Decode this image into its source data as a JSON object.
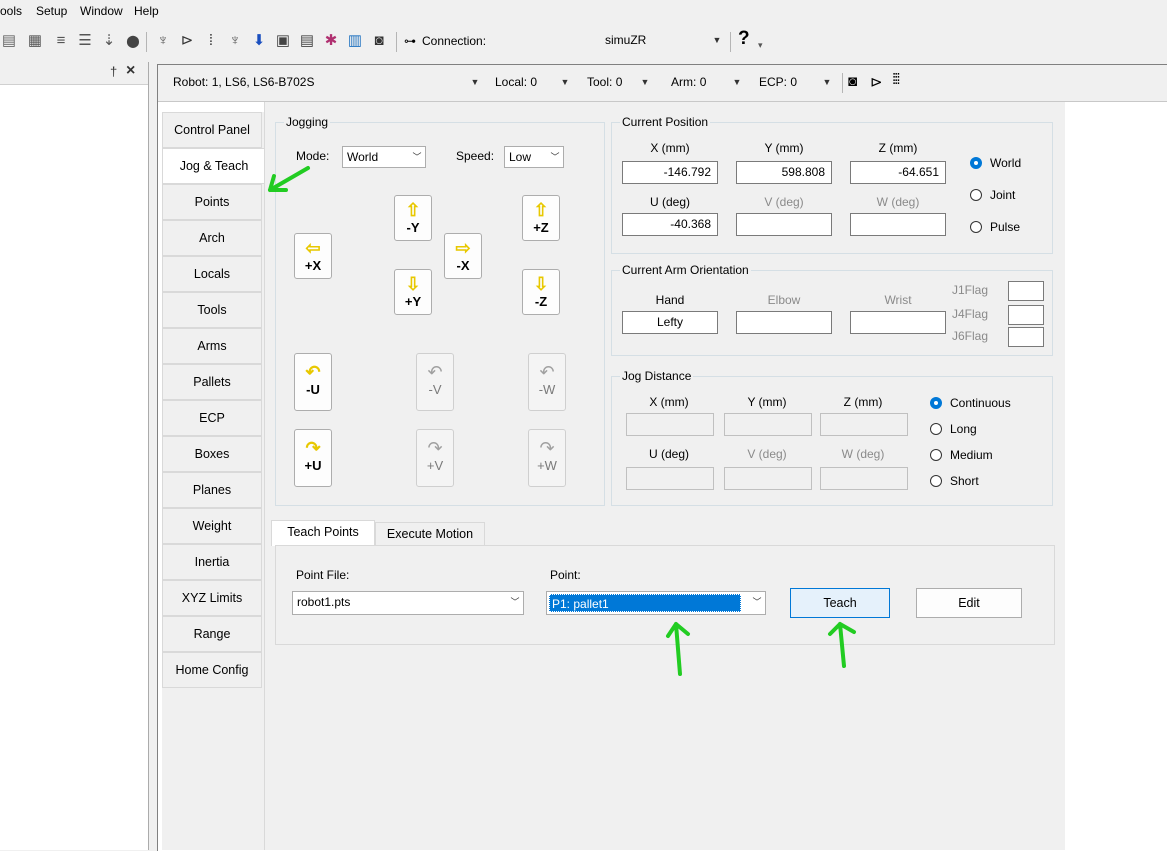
{
  "menu": {
    "items": [
      "ools",
      "Setup",
      "Window",
      "Help"
    ]
  },
  "toolbar": {
    "connection_label": "Connection:",
    "connection_value": "simuZR",
    "help_symbol": "?"
  },
  "dock": {
    "pin_symbol": "†",
    "close_symbol": "×"
  },
  "robotbar": {
    "robot_label": "Robot:",
    "robot_value": "1, LS6, LS6-B702S",
    "local_label": "Local:",
    "local_value": "0",
    "tool_label": "Tool:",
    "tool_value": "0",
    "arm_label": "Arm:",
    "arm_value": "0",
    "ecp_label": "ECP:",
    "ecp_value": "0"
  },
  "sidebar": {
    "tabs": [
      {
        "label": "Control Panel"
      },
      {
        "label": "Jog & Teach"
      },
      {
        "label": "Points"
      },
      {
        "label": "Arch"
      },
      {
        "label": "Locals"
      },
      {
        "label": "Tools"
      },
      {
        "label": "Arms"
      },
      {
        "label": "Pallets"
      },
      {
        "label": "ECP"
      },
      {
        "label": "Boxes"
      },
      {
        "label": "Planes"
      },
      {
        "label": "Weight"
      },
      {
        "label": "Inertia"
      },
      {
        "label": "XYZ Limits"
      },
      {
        "label": "Range"
      },
      {
        "label": "Home Config"
      }
    ],
    "active_index": 1
  },
  "jogging": {
    "title": "Jogging",
    "mode_label": "Mode:",
    "mode_value": "World",
    "speed_label": "Speed:",
    "speed_value": "Low",
    "buttons": {
      "plus_x": "+X",
      "minus_x": "-X",
      "minus_y": "-Y",
      "plus_y": "+Y",
      "plus_z": "+Z",
      "minus_z": "-Z",
      "minus_u": "-U",
      "plus_u": "+U",
      "minus_v": "-V",
      "plus_v": "+V",
      "minus_w": "-W",
      "plus_w": "+W"
    }
  },
  "current_position": {
    "title": "Current Position",
    "x_label": "X (mm)",
    "x_value": "-146.792",
    "y_label": "Y (mm)",
    "y_value": "598.808",
    "z_label": "Z (mm)",
    "z_value": "-64.651",
    "u_label": "U (deg)",
    "u_value": "-40.368",
    "v_label": "V (deg)",
    "v_value": "",
    "w_label": "W (deg)",
    "w_value": "",
    "options": [
      "World",
      "Joint",
      "Pulse"
    ],
    "selected": "World"
  },
  "arm_orientation": {
    "title": "Current Arm Orientation",
    "hand_label": "Hand",
    "hand_value": "Lefty",
    "elbow_label": "Elbow",
    "elbow_value": "",
    "wrist_label": "Wrist",
    "wrist_value": "",
    "j1_label": "J1Flag",
    "j4_label": "J4Flag",
    "j6_label": "J6Flag"
  },
  "jog_distance": {
    "title": "Jog Distance",
    "x_label": "X (mm)",
    "y_label": "Y (mm)",
    "z_label": "Z (mm)",
    "u_label": "U (deg)",
    "v_label": "V (deg)",
    "w_label": "W (deg)",
    "options": [
      "Continuous",
      "Long",
      "Medium",
      "Short"
    ],
    "selected": "Continuous"
  },
  "bottom_tabs": {
    "tabs": [
      "Teach Points",
      "Execute Motion"
    ],
    "active_index": 0
  },
  "teach": {
    "point_file_label": "Point File:",
    "point_file_value": "robot1.pts",
    "point_label": "Point:",
    "point_value": "P1: pallet1",
    "teach_button": "Teach",
    "edit_button": "Edit"
  },
  "colors": {
    "accent": "#0078d7",
    "annotation": "#22cc22",
    "jog_arrow": "#ffe84a"
  }
}
